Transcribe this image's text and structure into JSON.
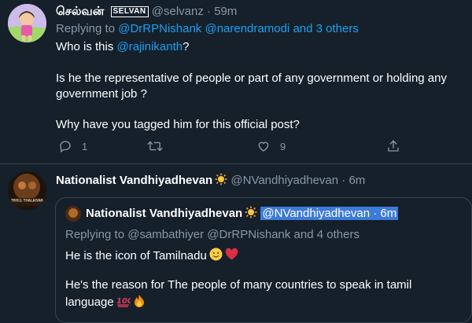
{
  "tweet1": {
    "display_name": "செல்வன்",
    "name_badge": "SELVAN",
    "handle": "@selvanz",
    "separator": "·",
    "time": "59m",
    "replying_prefix": "Replying to",
    "replying_users": "@DrRPNishank @narendramodi",
    "replying_and": "and",
    "replying_others": "3 others",
    "line1_text": "Who is this",
    "line1_mention": "@rajinikanth",
    "line1_suffix": "?",
    "line2": "Is he the representative of people or part of any government or holding any",
    "line3": "government job ?",
    "line4": "Why have you tagged him for this official post?",
    "reply_count": "1",
    "like_count": "9"
  },
  "tweet2": {
    "display_name": "Nationalist Vandhiyadhevan",
    "handle": "@NVandhiyadhevan",
    "separator": "·",
    "time": "6m",
    "avatar_caption": "TROLL THALAIVAR"
  },
  "quoted": {
    "display_name": "Nationalist Vandhiyadhevan",
    "handle_time": "@NVandhiyadhevan · 6m",
    "replying": "Replying to @sambathiyer @DrRPNishank and 4 others",
    "line1": "He is the icon of Tamilnadu",
    "line2": "He's the reason for The people of many countries to speak in tamil",
    "line3": "language"
  },
  "colors": {
    "background": "#15202b",
    "link": "#1da1f2",
    "muted": "#8899a6",
    "border": "#38444d",
    "selection": "#3d7bd8"
  },
  "icons": [
    "reply-icon",
    "retweet-icon",
    "like-icon",
    "share-icon",
    "sun-emoji-icon",
    "slight-smile-emoji-icon",
    "red-heart-emoji-icon",
    "hundred-points-emoji-icon",
    "fire-emoji-icon"
  ]
}
